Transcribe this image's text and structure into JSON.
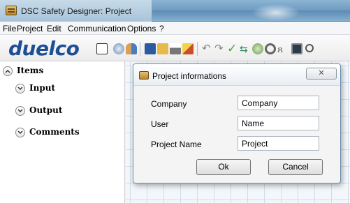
{
  "window": {
    "title": "DSC Safety Designer: Project"
  },
  "menu": [
    "File",
    "Project",
    "Edit",
    "Communication",
    "Options",
    "?"
  ],
  "toolbar": {
    "logo": "duelco",
    "icons": [
      "new-project-icon",
      "settings-icon",
      "users-icon",
      "save-icon",
      "open-folder-icon",
      "print-icon",
      "edit-icon",
      "undo-icon",
      "redo-icon",
      "check-icon",
      "transfer-icon",
      "module-icon",
      "target-icon",
      "probe-icon",
      "monitor-icon",
      "zoom-icon"
    ]
  },
  "sidebar": {
    "items": [
      "Items",
      "Input",
      "Output",
      "Comments"
    ]
  },
  "dialog": {
    "title": "Project informations",
    "fields": [
      {
        "label": "Company",
        "value": "Company"
      },
      {
        "label": "User",
        "value": "Name"
      },
      {
        "label": "Project Name",
        "value": "Project"
      }
    ],
    "ok_label": "Ok",
    "cancel_label": "Cancel"
  }
}
